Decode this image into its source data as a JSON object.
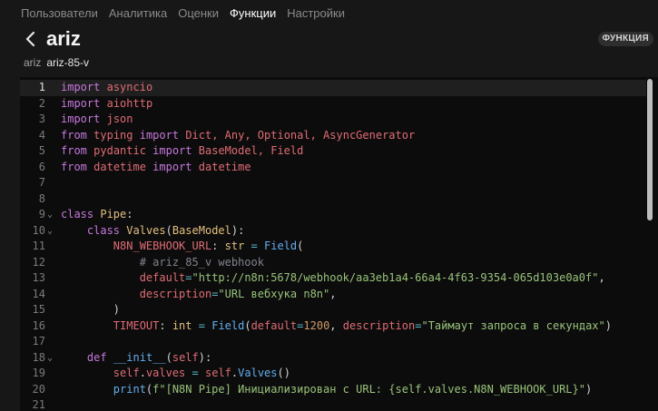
{
  "nav": [
    "Пользователи",
    "Аналитика",
    "Оценки",
    "Функции",
    "Настройки"
  ],
  "nav_active": 3,
  "title": "ariz",
  "badge": "ФУНКЦИЯ",
  "function_id": "ariz",
  "function_name": "ariz-85-v",
  "current_line": 1,
  "code_lines": [
    {
      "n": "1",
      "fold": false,
      "t": [
        [
          "kw",
          "import"
        ],
        [
          "pl",
          " "
        ],
        [
          "mod",
          "asyncio"
        ]
      ]
    },
    {
      "n": "2",
      "fold": false,
      "t": [
        [
          "kw",
          "import"
        ],
        [
          "pl",
          " "
        ],
        [
          "mod",
          "aiohttp"
        ]
      ]
    },
    {
      "n": "3",
      "fold": false,
      "t": [
        [
          "kw",
          "import"
        ],
        [
          "pl",
          " "
        ],
        [
          "mod",
          "json"
        ]
      ]
    },
    {
      "n": "4",
      "fold": false,
      "t": [
        [
          "kw",
          "from"
        ],
        [
          "pl",
          " "
        ],
        [
          "mod",
          "typing"
        ],
        [
          "pl",
          " "
        ],
        [
          "kw",
          "import"
        ],
        [
          "pl",
          " "
        ],
        [
          "mod",
          "Dict, Any, Optional, AsyncGenerator"
        ]
      ]
    },
    {
      "n": "5",
      "fold": false,
      "t": [
        [
          "kw",
          "from"
        ],
        [
          "pl",
          " "
        ],
        [
          "mod",
          "pydantic"
        ],
        [
          "pl",
          " "
        ],
        [
          "kw",
          "import"
        ],
        [
          "pl",
          " "
        ],
        [
          "mod",
          "BaseModel, Field"
        ]
      ]
    },
    {
      "n": "6",
      "fold": false,
      "t": [
        [
          "kw",
          "from"
        ],
        [
          "pl",
          " "
        ],
        [
          "mod",
          "datetime"
        ],
        [
          "pl",
          " "
        ],
        [
          "kw",
          "import"
        ],
        [
          "pl",
          " "
        ],
        [
          "mod",
          "datetime"
        ]
      ]
    },
    {
      "n": "7",
      "fold": false,
      "t": []
    },
    {
      "n": "8",
      "fold": false,
      "t": []
    },
    {
      "n": "9",
      "fold": true,
      "t": [
        [
          "kw",
          "class"
        ],
        [
          "pl",
          " "
        ],
        [
          "cls",
          "Pipe"
        ],
        [
          "pl",
          ":"
        ]
      ]
    },
    {
      "n": "10",
      "fold": true,
      "t": [
        [
          "pl",
          "    "
        ],
        [
          "kw",
          "class"
        ],
        [
          "pl",
          " "
        ],
        [
          "cls",
          "Valves"
        ],
        [
          "pl",
          "("
        ],
        [
          "cls",
          "BaseModel"
        ],
        [
          "pl",
          "):"
        ]
      ]
    },
    {
      "n": "11",
      "fold": false,
      "t": [
        [
          "pl",
          "        "
        ],
        [
          "var",
          "N8N_WEBHOOK_URL"
        ],
        [
          "pl",
          ": "
        ],
        [
          "cls",
          "str"
        ],
        [
          "pl",
          " "
        ],
        [
          "op",
          "="
        ],
        [
          "pl",
          " "
        ],
        [
          "fn",
          "Field"
        ],
        [
          "pl",
          "("
        ]
      ]
    },
    {
      "n": "12",
      "fold": false,
      "t": [
        [
          "pl",
          "            "
        ],
        [
          "cm",
          "# ariz_85_v webhook"
        ]
      ]
    },
    {
      "n": "13",
      "fold": false,
      "t": [
        [
          "pl",
          "            "
        ],
        [
          "var",
          "default"
        ],
        [
          "op",
          "="
        ],
        [
          "str",
          "\"http://n8n:5678/webhook/aa3eb1a4-66a4-4f63-9354-065d103e0a0f\""
        ],
        [
          "pl",
          ","
        ]
      ]
    },
    {
      "n": "14",
      "fold": false,
      "t": [
        [
          "pl",
          "            "
        ],
        [
          "var",
          "description"
        ],
        [
          "op",
          "="
        ],
        [
          "str",
          "\"URL вебхука n8n\""
        ],
        [
          "pl",
          ","
        ]
      ]
    },
    {
      "n": "15",
      "fold": false,
      "t": [
        [
          "pl",
          "        )"
        ]
      ]
    },
    {
      "n": "16",
      "fold": false,
      "t": [
        [
          "pl",
          "        "
        ],
        [
          "var",
          "TIMEOUT"
        ],
        [
          "pl",
          ": "
        ],
        [
          "cls",
          "int"
        ],
        [
          "pl",
          " "
        ],
        [
          "op",
          "="
        ],
        [
          "pl",
          " "
        ],
        [
          "fn",
          "Field"
        ],
        [
          "pl",
          "("
        ],
        [
          "var",
          "default"
        ],
        [
          "op",
          "="
        ],
        [
          "num",
          "1200"
        ],
        [
          "pl",
          ", "
        ],
        [
          "var",
          "description"
        ],
        [
          "op",
          "="
        ],
        [
          "str",
          "\"Таймаут запроса в секундах\""
        ],
        [
          "pl",
          ")"
        ]
      ]
    },
    {
      "n": "17",
      "fold": false,
      "t": []
    },
    {
      "n": "18",
      "fold": true,
      "t": [
        [
          "pl",
          "    "
        ],
        [
          "kw",
          "def"
        ],
        [
          "pl",
          " "
        ],
        [
          "fn",
          "__init__"
        ],
        [
          "pl",
          "("
        ],
        [
          "var",
          "self"
        ],
        [
          "pl",
          "):"
        ]
      ]
    },
    {
      "n": "19",
      "fold": false,
      "t": [
        [
          "pl",
          "        "
        ],
        [
          "var",
          "self"
        ],
        [
          "pl",
          "."
        ],
        [
          "var",
          "valves"
        ],
        [
          "pl",
          " "
        ],
        [
          "op",
          "="
        ],
        [
          "pl",
          " "
        ],
        [
          "var",
          "self"
        ],
        [
          "pl",
          "."
        ],
        [
          "fn",
          "Valves"
        ],
        [
          "pl",
          "()"
        ]
      ]
    },
    {
      "n": "20",
      "fold": false,
      "t": [
        [
          "pl",
          "        "
        ],
        [
          "fn",
          "print"
        ],
        [
          "pl",
          "("
        ],
        [
          "str",
          "f\"[N8N Pipe] Инициализирован с URL: {self.valves.N8N_WEBHOOK_URL}\""
        ],
        [
          "pl",
          ")"
        ]
      ]
    },
    {
      "n": "21",
      "fold": false,
      "t": []
    }
  ]
}
